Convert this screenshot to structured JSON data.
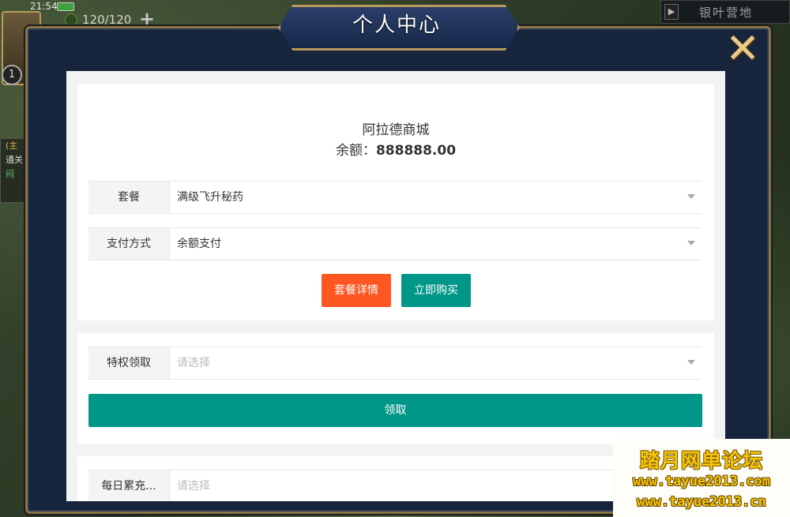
{
  "hud": {
    "time": "21:54",
    "energy": "120/120",
    "plus": "+",
    "level": "1",
    "map_label": "银叶营地",
    "quest_lines": [
      "(主",
      "通关",
      "闷"
    ]
  },
  "modal": {
    "title": "个人中心",
    "close_symbol": "✕"
  },
  "shop": {
    "name": "阿拉德商城",
    "balance_label": "余额：",
    "balance_value": "888888.00"
  },
  "form": {
    "package": {
      "label": "套餐",
      "value": "满级飞升秘药"
    },
    "payment": {
      "label": "支付方式",
      "value": "余额支付"
    },
    "privilege": {
      "label": "特权领取",
      "placeholder": "请选择"
    },
    "daily": {
      "label": "每日累充...",
      "placeholder": "请选择"
    }
  },
  "buttons": {
    "details": "套餐详情",
    "buy": "立即购买",
    "claim": "领取"
  },
  "watermark": {
    "title": "踏月网单论坛",
    "url1": "www.tayue2013.com",
    "url2": "www.tayue2013.cn"
  },
  "colors": {
    "orange_button": "#ff5722",
    "teal_button": "#009688",
    "frame_gold": "#8c7544",
    "modal_bg": "#16243c"
  }
}
